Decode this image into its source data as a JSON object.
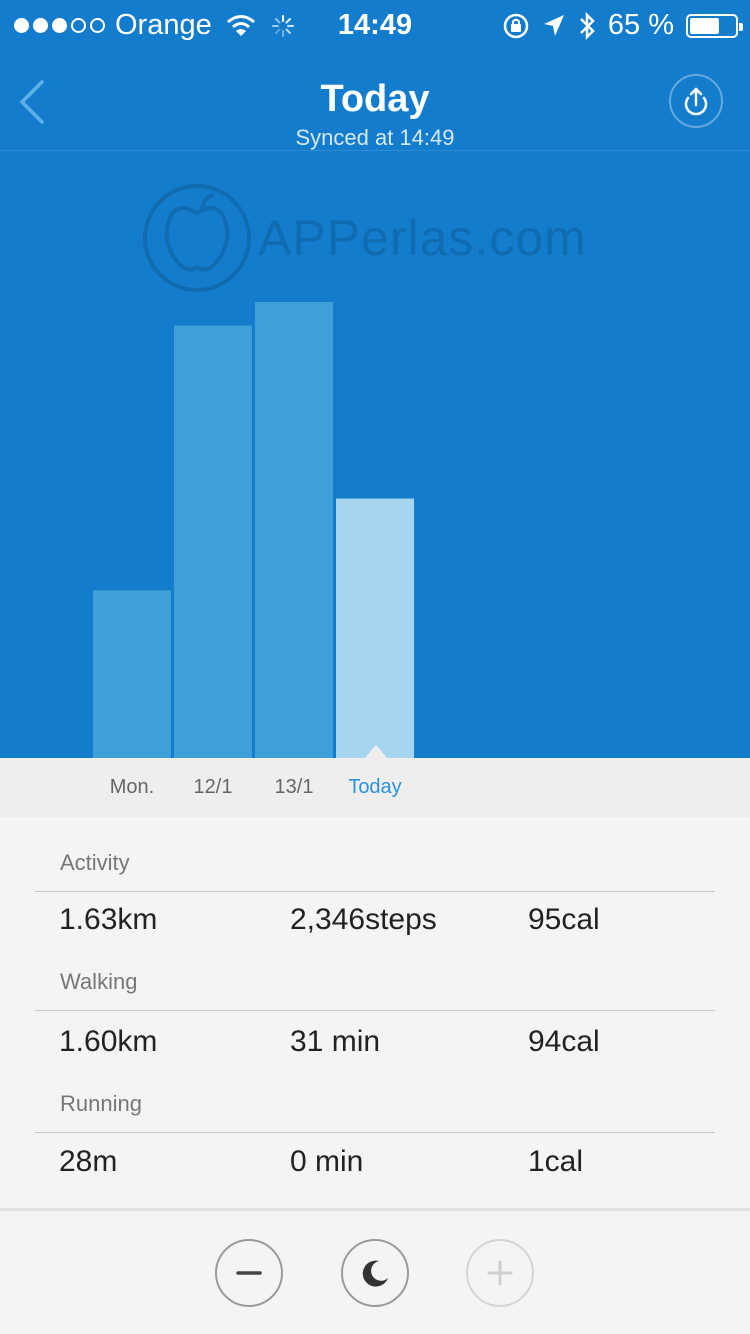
{
  "status_bar": {
    "carrier": "Orange",
    "time": "14:49",
    "battery_percent": "65 %",
    "battery_level": 0.65,
    "signal_bars_filled": 3,
    "signal_bars_total": 5
  },
  "header": {
    "title": "Today",
    "subtitle": "Synced at 14:49",
    "back_icon": "chevron-left-icon",
    "share_icon": "upload-icon"
  },
  "watermark": {
    "text": "APPerlas.com"
  },
  "chart_data": {
    "type": "bar",
    "categories": [
      "Mon.",
      "12/1",
      "13/1",
      "Today"
    ],
    "values": [
      157,
      405,
      427,
      243
    ],
    "ylim": [
      0,
      560
    ],
    "selected_index": 3,
    "grid": false,
    "colors": {
      "bar": "#3f9fd8",
      "selected_bar": "#a7d4ee",
      "background": "#137ccc",
      "active_label": "#2b93d6"
    }
  },
  "stats": {
    "activity": {
      "label": "Activity",
      "distance": "1.63km",
      "steps": "2,346steps",
      "calories": "95cal"
    },
    "walking": {
      "label": "Walking",
      "distance": "1.60km",
      "duration": "31 min",
      "calories": "94cal"
    },
    "running": {
      "label": "Running",
      "distance": "28m",
      "duration": "0 min",
      "calories": "1cal"
    }
  },
  "controls": {
    "minus_icon": "minus-icon",
    "sleep_icon": "moon-icon",
    "plus_icon": "plus-icon",
    "plus_enabled": false
  }
}
